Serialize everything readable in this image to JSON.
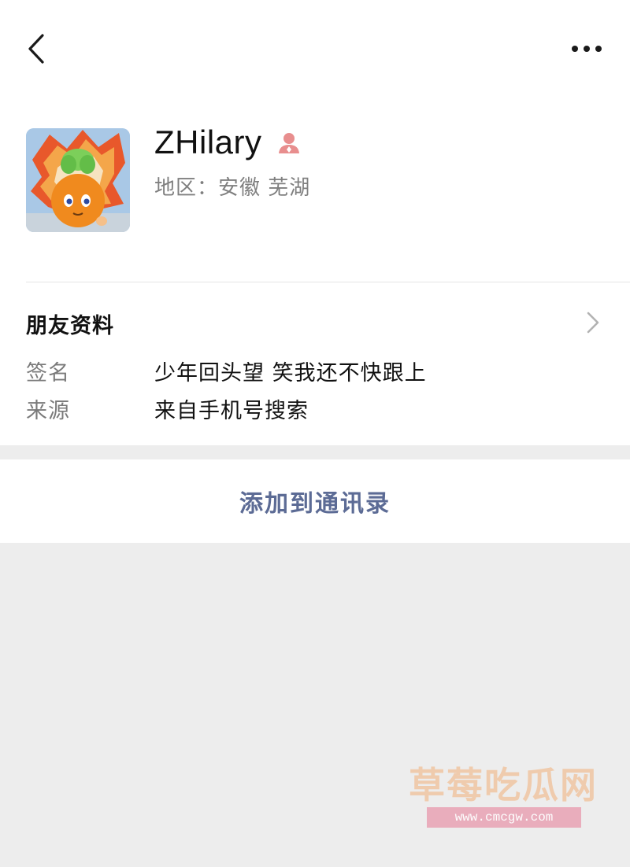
{
  "nav": {
    "back_icon": "chevron-left-icon",
    "more_icon": "more-horizontal-icon"
  },
  "profile": {
    "avatar_icon": "cartoon-radish-avatar",
    "nickname": "ZHilary",
    "gender_icon": "female-user-icon",
    "gender_color": "#e88e8e",
    "region": "地区：安徽 芜湖"
  },
  "info": {
    "section_title": "朋友资料",
    "chevron_icon": "chevron-right-icon",
    "rows": [
      {
        "label": "签名",
        "value": "少年回头望 笑我还不快跟上"
      },
      {
        "label": "来源",
        "value": "来自手机号搜索"
      }
    ]
  },
  "action": {
    "label": "添加到通讯录",
    "color": "#5c6b95"
  },
  "watermark": {
    "title": "草莓吃瓜网",
    "url": "www.cmcgw.com"
  }
}
